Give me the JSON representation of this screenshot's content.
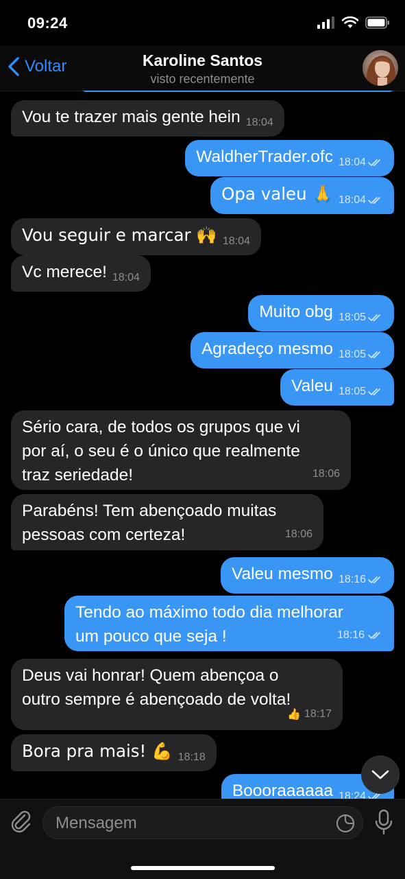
{
  "status": {
    "time": "09:24"
  },
  "header": {
    "back_label": "Voltar",
    "contact_name": "Karoline Santos",
    "contact_status": "visto recentemente"
  },
  "messages": [
    {
      "text": "Vou te trazer mais gente hein",
      "time": "18:04",
      "dir": "in"
    },
    {
      "text": "WaldherTrader.ofc",
      "time": "18:04",
      "dir": "out"
    },
    {
      "text": "Opa valeu 🙏",
      "time": "18:04",
      "dir": "out"
    },
    {
      "text": "Vou seguir e marcar 🙌",
      "time": "18:04",
      "dir": "in"
    },
    {
      "text": "Vc merece!",
      "time": "18:04",
      "dir": "in"
    },
    {
      "text": "Muito obg",
      "time": "18:05",
      "dir": "out"
    },
    {
      "text": "Agradeço mesmo",
      "time": "18:05",
      "dir": "out"
    },
    {
      "text": "Valeu",
      "time": "18:05",
      "dir": "out"
    },
    {
      "line1": "Sério cara, de todos os grupos que vi",
      "line2": "por aí, o seu é o único que realmente",
      "line3": "traz seriedade!",
      "time": "18:06",
      "dir": "in"
    },
    {
      "line1": "Parabéns! Tem abençoado muitas",
      "line2": "pessoas com certeza!",
      "time": "18:06",
      "dir": "in"
    },
    {
      "text": "Valeu mesmo",
      "time": "18:16",
      "dir": "out"
    },
    {
      "line1": "Tendo ao máximo todo dia melhorar",
      "line2": "um pouco que seja !",
      "time": "18:16",
      "dir": "out"
    },
    {
      "line1": "Deus vai honrar! Quem abençoa o",
      "line2": "outro sempre é abençoado de volta!",
      "reaction": "👍",
      "time": "18:17",
      "dir": "in"
    },
    {
      "text": "Bora pra mais! 💪",
      "time": "18:18",
      "dir": "in"
    },
    {
      "text": "Boooraaaaaa",
      "time": "18:24",
      "dir": "out"
    }
  ],
  "composer": {
    "placeholder": "Mensagem"
  }
}
